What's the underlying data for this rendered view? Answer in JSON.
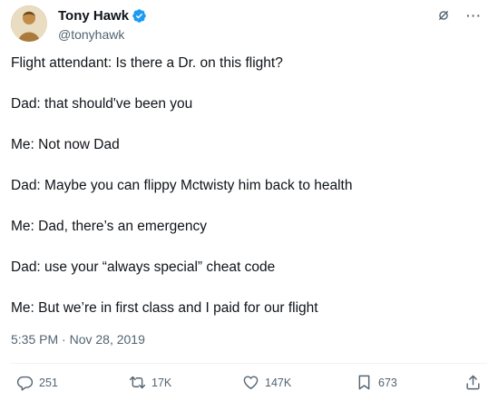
{
  "author": {
    "display_name": "Tony Hawk",
    "handle": "@tonyhawk",
    "verified": true,
    "verified_color": "#1d9bf0"
  },
  "icons": {
    "grok": "grok-icon",
    "more": "more-icon",
    "reply": "reply-icon",
    "repost": "repost-icon",
    "like": "heart-icon",
    "bookmark": "bookmark-icon",
    "share": "share-icon"
  },
  "more_glyph": "···",
  "tweet": {
    "lines": [
      "Flight attendant: Is there a Dr. on this flight?",
      "Dad: that should've been you",
      "Me: Not now Dad",
      "Dad: Maybe you can flippy Mctwisty him back to health",
      "Me: Dad, there’s an emergency",
      "Dad: use your “always special” cheat code",
      "Me: But we’re in first class and I paid for our flight"
    ],
    "timestamp": "5:35 PM · Nov 28, 2019"
  },
  "stats": {
    "replies": "251",
    "reposts": "17K",
    "likes": "147K",
    "bookmarks": "673"
  }
}
